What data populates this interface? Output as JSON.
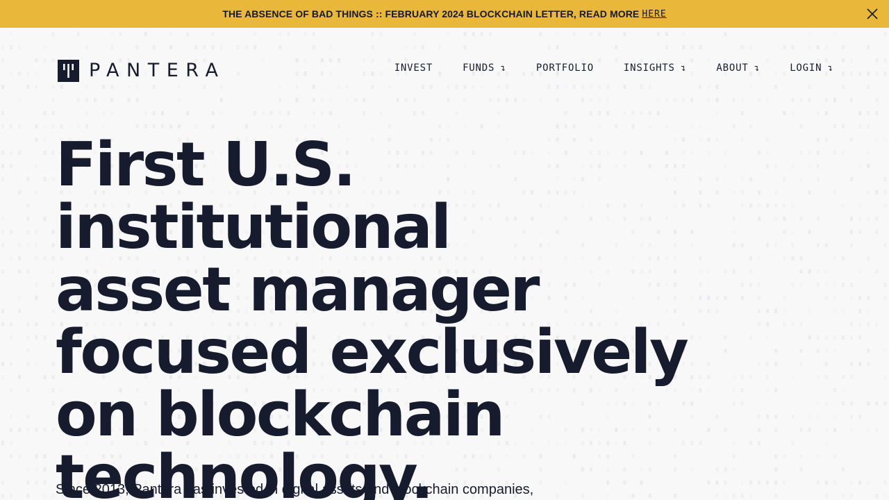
{
  "announcement": {
    "text": "THE ABSENCE OF BAD THINGS :: FEBRUARY 2024 BLOCKCHAIN LETTER, READ MORE",
    "link_label": "HERE"
  },
  "brand": {
    "name": "PANTERA"
  },
  "nav": {
    "items": [
      {
        "label": "INVEST",
        "arrow": ""
      },
      {
        "label": "FUNDS",
        "arrow": "↴"
      },
      {
        "label": "PORTFOLIO",
        "arrow": ""
      },
      {
        "label": "INSIGHTS",
        "arrow": "↴"
      },
      {
        "label": "ABOUT",
        "arrow": "↴"
      },
      {
        "label": "LOGIN",
        "arrow": "↴"
      }
    ]
  },
  "hero": {
    "line1": "First U.S. institutional",
    "line2": "asset manager",
    "line3": "focused exclusively",
    "line4": "on blockchain",
    "line5": "technology.",
    "subtitle": "Since 2013, Pantera has invested in digital assets and blockchain companies,"
  },
  "colors": {
    "announcement_bg": "#e9b73a",
    "text": "#161b2e",
    "page_bg": "#f8f8f9"
  },
  "icons": {
    "close": "close-icon",
    "logo": "pantera-logo-mark-icon",
    "dropdown": "dropdown-arrow-icon"
  }
}
